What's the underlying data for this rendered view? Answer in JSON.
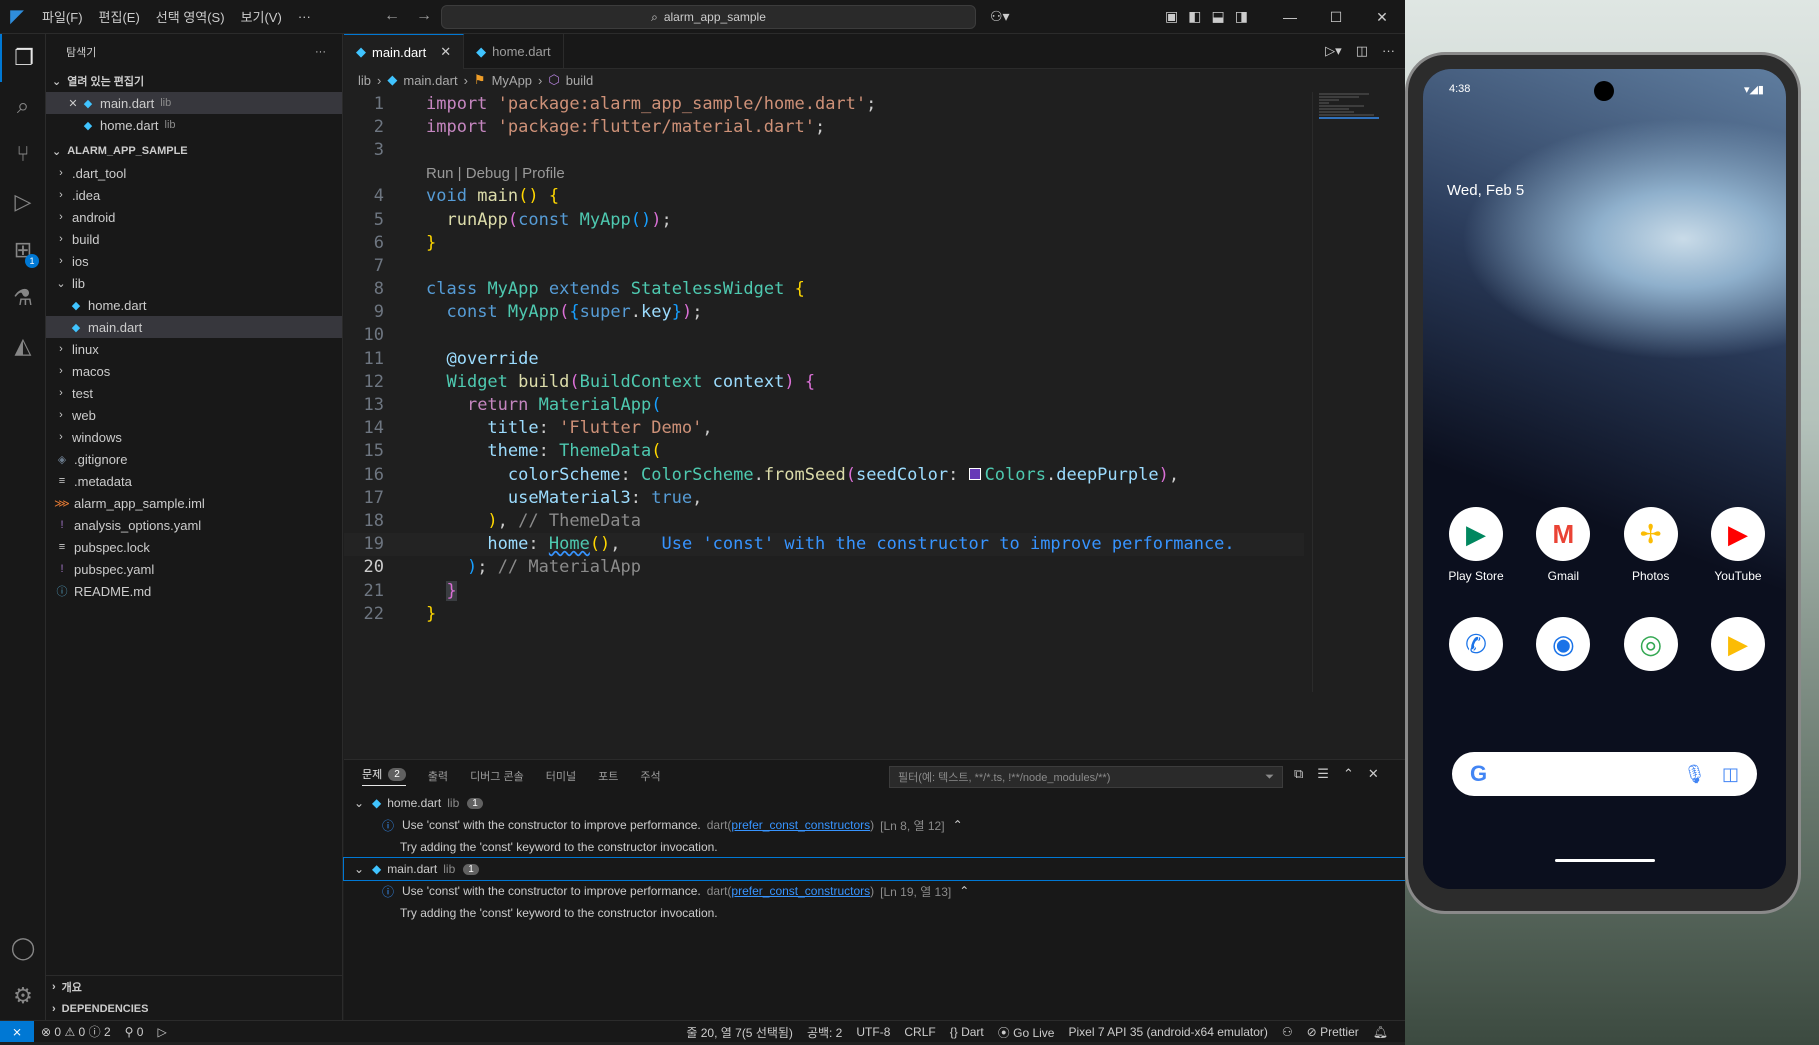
{
  "titlebar": {
    "menus": [
      "파일(F)",
      "편집(E)",
      "선택 영역(S)",
      "보기(V)",
      "···"
    ],
    "search": "alarm_app_sample",
    "back_icon": "arrow-left-icon",
    "forward_icon": "arrow-right-icon",
    "window_controls": [
      "minimize-icon",
      "maximize-icon",
      "close-icon"
    ]
  },
  "activity_bar": {
    "items": [
      "explorer-icon",
      "search-icon",
      "source-control-icon",
      "run-debug-icon",
      "extensions-icon",
      "testing-icon",
      "flutter-icon"
    ],
    "extensions_badge": "1",
    "bottom": [
      "account-icon",
      "manage-gear-icon"
    ]
  },
  "explorer": {
    "title": "탐색기",
    "more": "···",
    "open_editors_title": "열려 있는 편집기",
    "open_editors": [
      {
        "name": "main.dart",
        "desc": "lib"
      },
      {
        "name": "home.dart",
        "desc": "lib"
      }
    ],
    "project_title": "ALARM_APP_SAMPLE",
    "tree": [
      {
        "name": ".dart_tool",
        "kind": "folder"
      },
      {
        "name": ".idea",
        "kind": "folder"
      },
      {
        "name": "android",
        "kind": "folder"
      },
      {
        "name": "build",
        "kind": "folder"
      },
      {
        "name": "ios",
        "kind": "folder"
      },
      {
        "name": "lib",
        "kind": "folder-open"
      },
      {
        "name": "home.dart",
        "kind": "dart",
        "indent": 1
      },
      {
        "name": "main.dart",
        "kind": "dart",
        "indent": 1
      },
      {
        "name": "linux",
        "kind": "folder"
      },
      {
        "name": "macos",
        "kind": "folder"
      },
      {
        "name": "test",
        "kind": "folder"
      },
      {
        "name": "web",
        "kind": "folder"
      },
      {
        "name": "windows",
        "kind": "folder"
      },
      {
        "name": ".gitignore",
        "kind": "git"
      },
      {
        "name": ".metadata",
        "kind": "meta"
      },
      {
        "name": "alarm_app_sample.iml",
        "kind": "xml"
      },
      {
        "name": "analysis_options.yaml",
        "kind": "yaml"
      },
      {
        "name": "pubspec.lock",
        "kind": "meta"
      },
      {
        "name": "pubspec.yaml",
        "kind": "yaml"
      },
      {
        "name": "README.md",
        "kind": "info"
      }
    ],
    "outline_title": "개요",
    "dependencies_title": "DEPENDENCIES"
  },
  "editor": {
    "tabs": [
      {
        "name": "main.dart",
        "active": true
      },
      {
        "name": "home.dart",
        "active": false
      }
    ],
    "breadcrumb": [
      "lib",
      "main.dart",
      "MyApp",
      "build"
    ],
    "codelens": "Run | Debug | Profile",
    "line_numbers": [
      "1",
      "2",
      "3",
      "4",
      "5",
      "6",
      "7",
      "8",
      "9",
      "10",
      "11",
      "12",
      "13",
      "14",
      "15",
      "16",
      "17",
      "18",
      "19",
      "20",
      "21",
      "22"
    ],
    "lines": {
      "l1a": "import",
      "l1b": "'package:alarm_app_sample/home.dart'",
      "l1c": ";",
      "l2a": "import",
      "l2b": "'package:flutter/material.dart'",
      "l2c": ";",
      "l4a": "void",
      "l4b": "main",
      "l4c": "()",
      "l4d": " {",
      "l5a": "runApp",
      "l5b": "(",
      "l5c": "const",
      "l5d": "MyApp",
      "l5e": "()",
      "l5f": ")",
      "l5g": ";",
      "l6a": "}",
      "l8a": "class",
      "l8b": "MyApp",
      "l8c": "extends",
      "l8d": "StatelessWidget",
      "l8e": "{",
      "l9a": "const",
      "l9b": "MyApp",
      "l9c": "(",
      "l9d": "{",
      "l9e": "super",
      "l9f": ".",
      "l9g": "key",
      "l9h": "}",
      "l9i": ")",
      "l9j": ";",
      "l11a": "@override",
      "l12a": "Widget",
      "l12b": "build",
      "l12c": "(",
      "l12d": "BuildContext",
      "l12e": "context",
      "l12f": ")",
      "l12g": "{",
      "l13a": "return",
      "l13b": "MaterialApp",
      "l13c": "(",
      "l14a": "title",
      "l14b": ": ",
      "l14c": "'Flutter Demo'",
      "l14d": ",",
      "l15a": "theme",
      "l15b": ": ",
      "l15c": "ThemeData",
      "l15d": "(",
      "l16a": "colorScheme",
      "l16b": ": ",
      "l16c": "ColorScheme",
      "l16d": ".",
      "l16e": "fromSeed",
      "l16f": "(",
      "l16g": "seedColor",
      "l16h": ": ",
      "l16i": "Colors",
      "l16j": ".",
      "l16k": "deepPurple",
      "l16l": ")",
      "l16m": ",",
      "l17a": "useMaterial3",
      "l17b": ": ",
      "l17c": "true",
      "l17d": ",",
      "l18a": ")",
      "l18b": ", ",
      "l18c": "// ThemeData",
      "l19a": "home",
      "l19b": ": ",
      "l19c": "Home",
      "l19d": "()",
      "l19e": ",",
      "l19f": "Use 'const' with the constructor to improve performance.",
      "l20a": ")",
      "l20b": ";",
      "l20c": " // MaterialApp",
      "l21a": "}",
      "l22a": "}"
    },
    "seed_color": "#673ab7"
  },
  "panel": {
    "tabs": [
      "출력",
      "디버그 콘솔",
      "터미널",
      "포트",
      "주석"
    ],
    "problems_label": "문제",
    "problems_count": "2",
    "filter_placeholder": "필터(예: 텍스트, **/*.ts, !**/node_modules/**)",
    "groups": [
      {
        "file": "home.dart",
        "dir": "lib",
        "count": "1",
        "message": "Use 'const' with the constructor to improve performance.",
        "source": "dart(",
        "rule": "prefer_const_constructors",
        "source_end": ")",
        "location": "[Ln 8, 열 12]",
        "hint": "Try adding the 'const' keyword to the constructor invocation."
      },
      {
        "file": "main.dart",
        "dir": "lib",
        "count": "1",
        "message": "Use 'const' with the constructor to improve performance.",
        "source": "dart(",
        "rule": "prefer_const_constructors",
        "source_end": ")",
        "location": "[Ln 19, 열 13]",
        "hint": "Try adding the 'const' keyword to the constructor invocation."
      }
    ]
  },
  "statusbar": {
    "errors": "0",
    "warnings": "0",
    "infos": "2",
    "ports": "0",
    "cursor": "줄 20, 열 7(5 선택됨)",
    "spaces": "공백: 2",
    "encoding": "UTF-8",
    "eol": "CRLF",
    "language": "Dart",
    "golive": "Go Live",
    "device": "Pixel 7 API 35 (android-x64 emulator)",
    "prettier": "Prettier"
  },
  "phone": {
    "time": "4:38",
    "date": "Wed, Feb 5",
    "apps_row1": [
      {
        "label": "Play Store",
        "icon": "play-store-icon"
      },
      {
        "label": "Gmail",
        "icon": "gmail-icon"
      },
      {
        "label": "Photos",
        "icon": "photos-icon"
      },
      {
        "label": "YouTube",
        "icon": "youtube-icon"
      }
    ],
    "apps_row2": [
      {
        "icon": "phone-icon"
      },
      {
        "icon": "messages-icon"
      },
      {
        "icon": "chrome-icon"
      },
      {
        "icon": "play-store-icon"
      }
    ]
  }
}
